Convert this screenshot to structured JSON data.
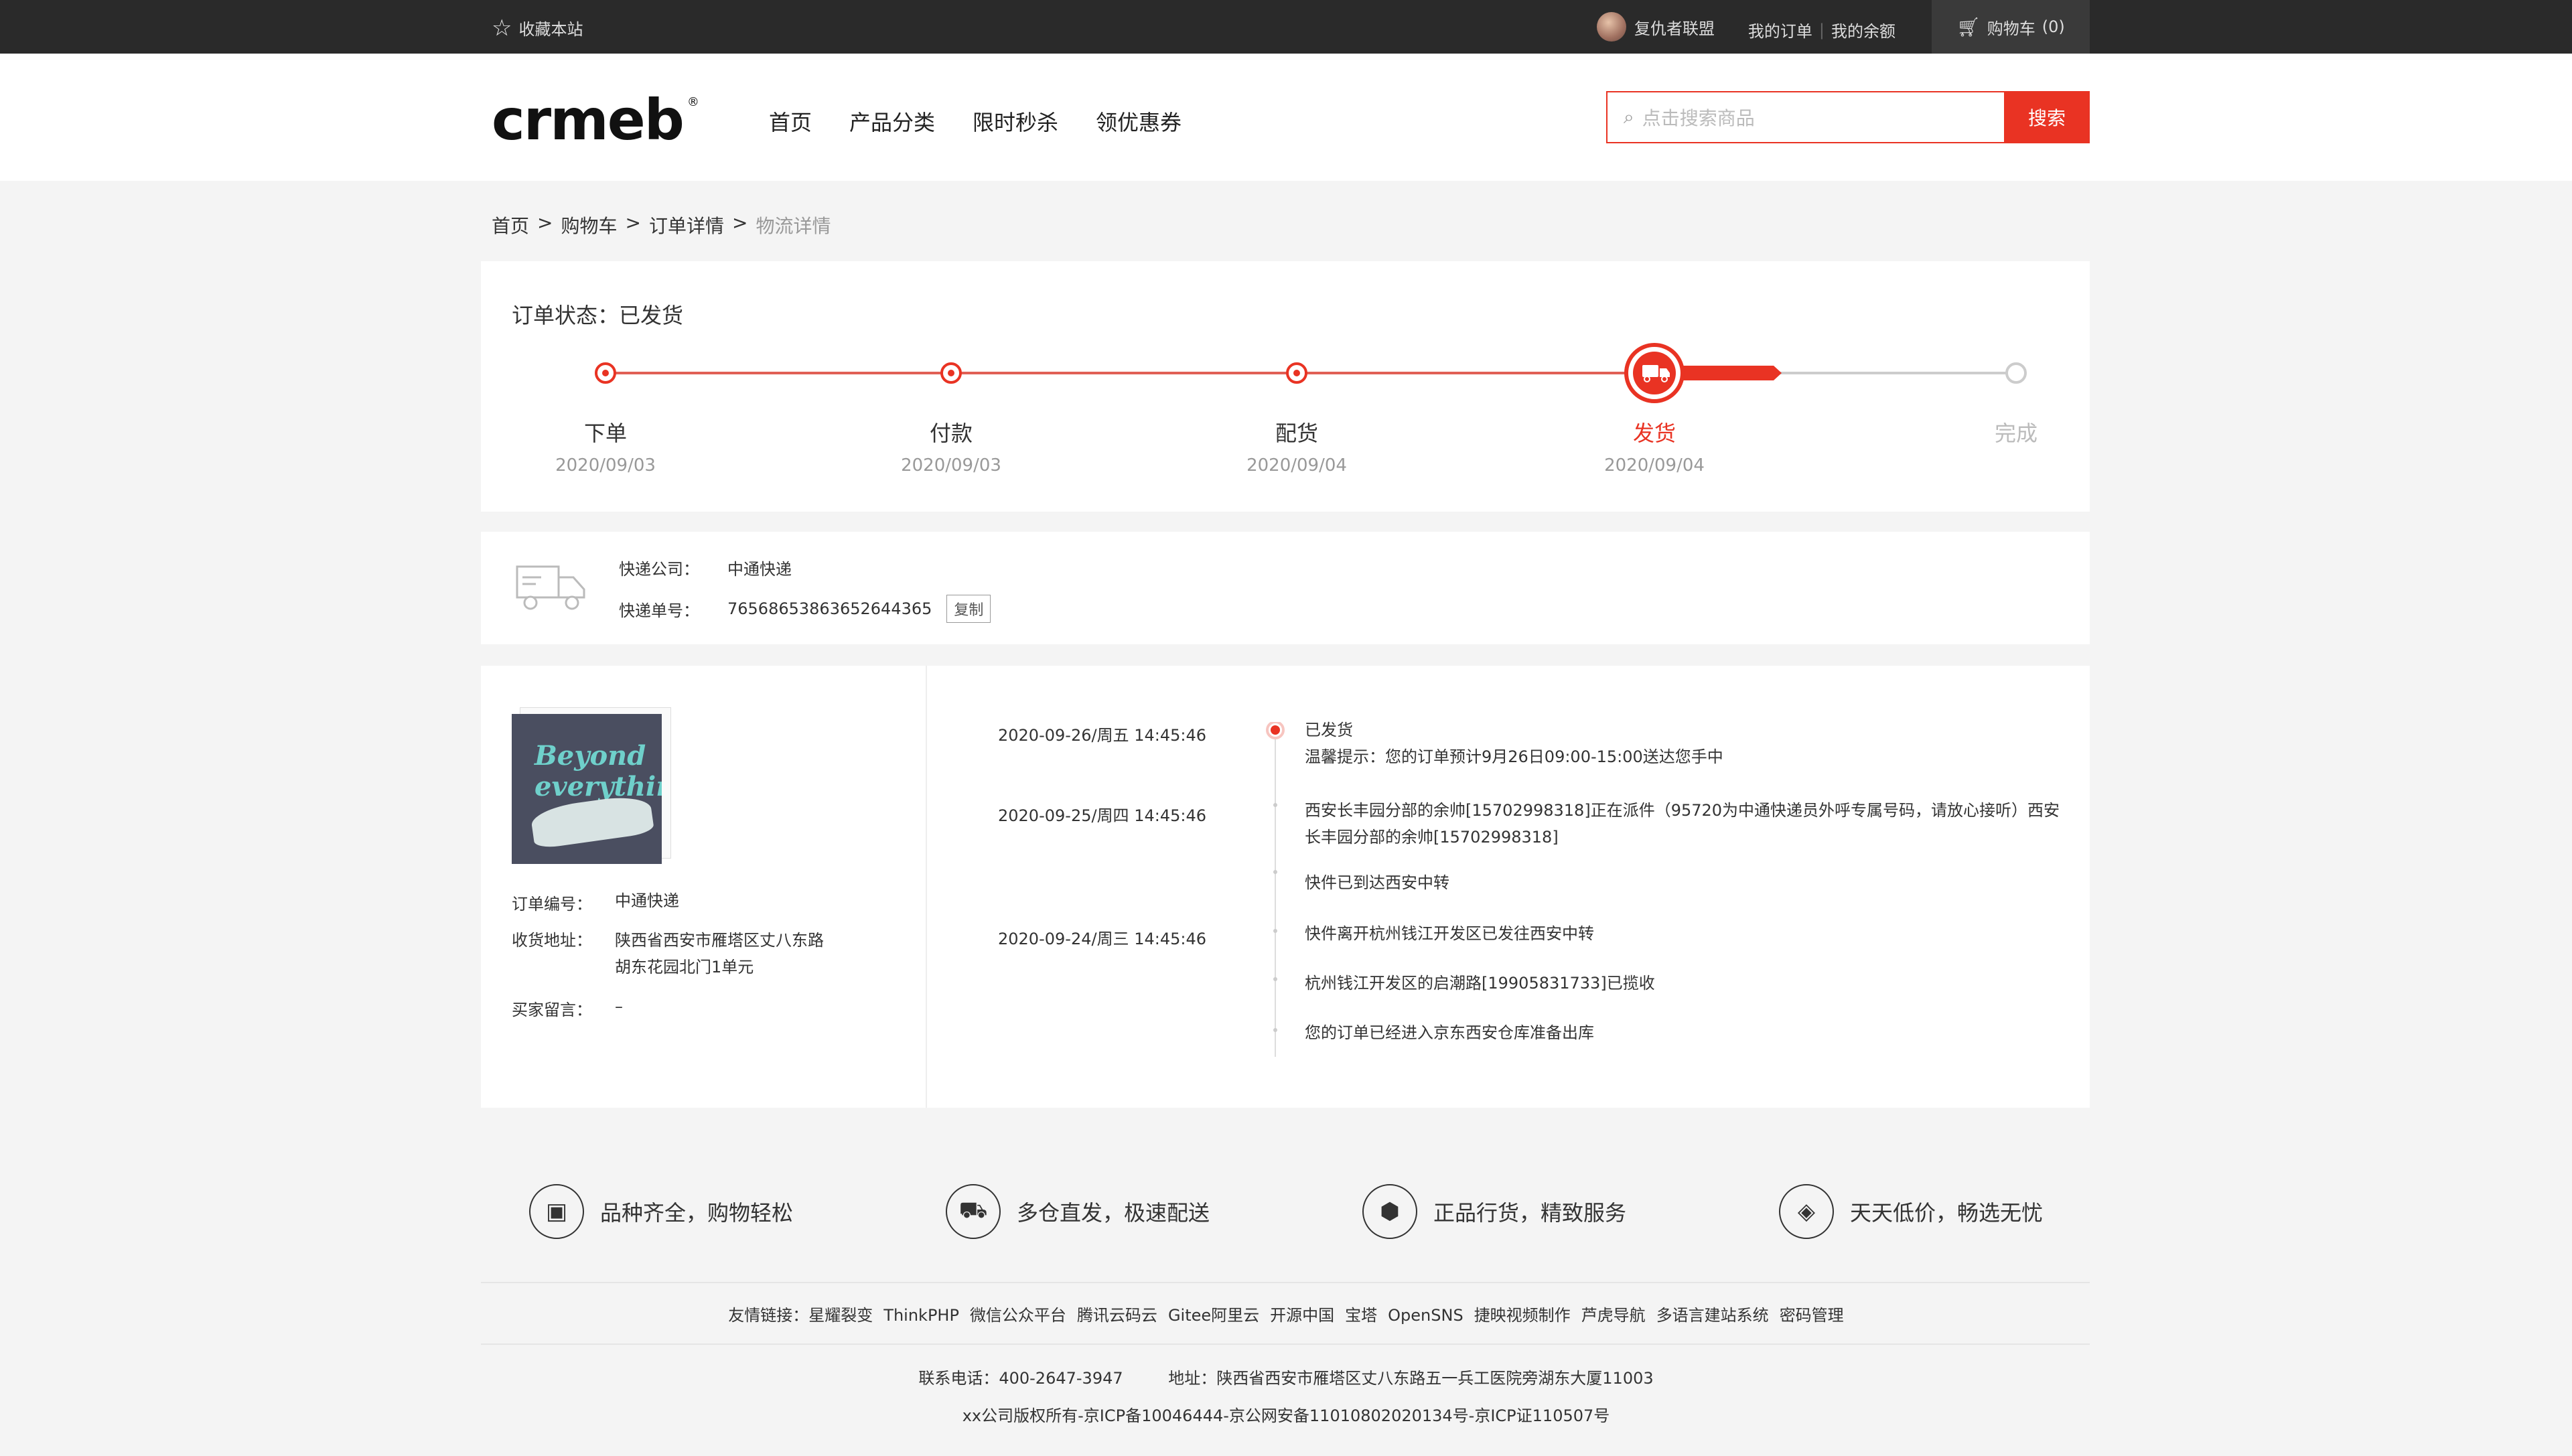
{
  "topbar": {
    "favorite": "收藏本站",
    "user_name": "复仇者联盟",
    "my_orders": "我的订单",
    "my_balance": "我的余额",
    "cart_label": "购物车",
    "cart_count": "(0)"
  },
  "header": {
    "logo": "crmeb",
    "logo_reg": "®",
    "nav": [
      "首页",
      "产品分类",
      "限时秒杀",
      "领优惠券"
    ],
    "search_placeholder": "点击搜索商品",
    "search_button": "搜索"
  },
  "breadcrumb": [
    "首页",
    "购物车",
    "订单详情",
    "物流详情"
  ],
  "breadcrumb_sep": ">",
  "order_status": {
    "label": "订单状态：已发货",
    "progress_fraction": 0.75,
    "steps": [
      {
        "label": "下单",
        "date": "2020/09/03"
      },
      {
        "label": "付款",
        "date": "2020/09/03"
      },
      {
        "label": "配货",
        "date": "2020/09/04"
      },
      {
        "label": "发货",
        "date": "2020/09/04"
      },
      {
        "label": "完成",
        "date": ""
      }
    ]
  },
  "courier": {
    "company_label": "快递公司：",
    "company": "中通快递",
    "tracking_label": "快递单号：",
    "tracking_no": "76568653863652644365",
    "copy_button": "复制"
  },
  "order": {
    "product_image_text": "Beyond everything",
    "number_label": "订单编号：",
    "number": "中通快递",
    "address_label": "收货地址：",
    "address": "陕西省西安市雁塔区丈八东路胡东花园北门1单元",
    "note_label": "买家留言：",
    "note": "–"
  },
  "logistics": [
    {
      "time": "2020-09-26/周五    14:45:46",
      "text": "已发货",
      "sub": "温馨提示：您的订单预计9月26日09:00-15:00送达您手中"
    },
    {
      "time": "2020-09-25/周四    14:45:46",
      "text": "西安长丰园分部的余帅[15702998318]正在派件（95720为中通快递员外呼专属号码，请放心接听）西安长丰园分部的余帅[15702998318]",
      "sub": ""
    },
    {
      "time": "",
      "text": "快件已到达西安中转",
      "sub": ""
    },
    {
      "time": "2020-09-24/周三    14:45:46",
      "text": "快件离开杭州钱江开发区已发往西安中转",
      "sub": ""
    },
    {
      "time": "",
      "text": "杭州钱江开发区的启潮路[19905831733]已揽收",
      "sub": ""
    },
    {
      "time": "",
      "text": "您的订单已经进入京东西安仓库准备出库",
      "sub": ""
    }
  ],
  "footer": {
    "features": [
      "品种齐全，购物轻松",
      "多仓直发，极速配送",
      "正品行货，精致服务",
      "天天低价，畅选无忧"
    ],
    "friend_label": "友情链接：",
    "friend_links": [
      "星耀裂变",
      "ThinkPHP",
      "微信公众平台",
      "腾讯云码云",
      "Gitee阿里云",
      "开源中国",
      "宝塔",
      "OpenSNS",
      "捷映视频制作",
      "芦虎导航",
      "多语言建站系统",
      "密码管理"
    ],
    "phone": "联系电话：400-2647-3947",
    "address": "地址：陕西省西安市雁塔区丈八东路五一兵工医院旁湖东大厦11003",
    "copyright": "xx公司版权所有-京ICP备10046444-京公网安备11010802020134号-京ICP证110507号"
  },
  "colors": {
    "accent": "#e93323",
    "topbar": "#2a2a2a"
  },
  "icons": {
    "favorite": "star-icon",
    "cart": "cart-icon",
    "search": "search-icon",
    "courier": "truck-icon"
  }
}
